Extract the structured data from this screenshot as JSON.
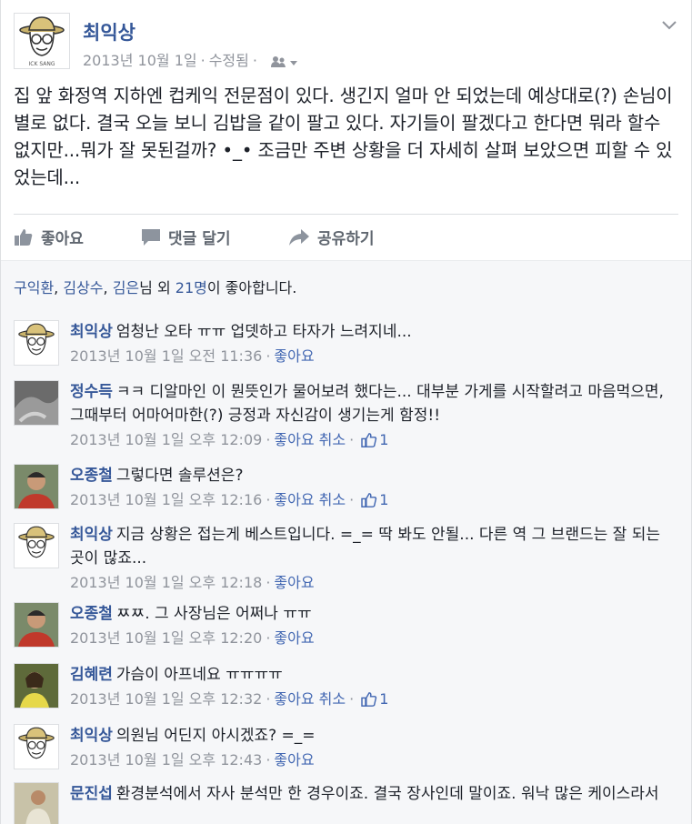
{
  "post": {
    "author": "최익상",
    "timestamp": "2013년 10월 1일",
    "edited": "수정됨",
    "body": "집 앞 화정역 지하엔 컵케익 전문점이 있다. 생긴지 얼마 안 되었는데 예상대로(?) 손님이 별로 없다. 결국 오늘 보니 김밥을 같이 팔고 있다. 자기들이 팔겠다고 한다면 뭐라 할수 없지만...뭐가 잘 못된걸까? •_• 조금만 주변 상황을 더 자세히 살펴 보았으면 피할 수 있었는데...",
    "actions": {
      "like": "좋아요",
      "comment": "댓글 달기",
      "share": "공유하기"
    }
  },
  "likes_summary": {
    "name1": "구익환",
    "name2": "김상수",
    "name3": "김은",
    "suffix1": "님 외 ",
    "others": "21명",
    "suffix2": "이 좋아합니다."
  },
  "comments": [
    {
      "author": "최익상",
      "text": "엄청난 오타 ㅠㅠ 업뎃하고 타자가 느려지네...",
      "time": "2013년 10월 1일 오전 11:36",
      "like": "좋아요",
      "cancel": "",
      "likes": ""
    },
    {
      "author": "정수득",
      "text": "ㅋㅋ 디알마인 이 뭔뜻인가 물어보려 했다는... 대부분 가게를 시작할려고 마음먹으면, 그때부터 어마어마한(?) 긍정과 자신감이 생기는게 함정!!",
      "time": "2013년 10월 1일 오후 12:09",
      "like": "좋아요",
      "cancel": "취소",
      "likes": "1"
    },
    {
      "author": "오종철",
      "text": "그렇다면 솔루션은?",
      "time": "2013년 10월 1일 오후 12:16",
      "like": "좋아요",
      "cancel": "취소",
      "likes": "1"
    },
    {
      "author": "최익상",
      "text": "지금 상황은 접는게 베스트입니다. =_= 딱 봐도 안될... 다른 역 그 브랜드는 잘 되는 곳이 많죠...",
      "time": "2013년 10월 1일 오후 12:18",
      "like": "좋아요",
      "cancel": "",
      "likes": ""
    },
    {
      "author": "오종철",
      "text": "ㅉㅉ. 그 사장님은 어쩌나 ㅠㅠ",
      "time": "2013년 10월 1일 오후 12:20",
      "like": "좋아요",
      "cancel": "",
      "likes": ""
    },
    {
      "author": "김혜련",
      "text": "가슴이 아프네요 ㅠㅠㅠㅠ",
      "time": "2013년 10월 1일 오후 12:32",
      "like": "좋아요",
      "cancel": "취소",
      "likes": "1"
    },
    {
      "author": "최익상",
      "text": "의원님 어딘지 아시겠죠? =_=",
      "time": "2013년 10월 1일 오후 12:43",
      "like": "좋아요",
      "cancel": "",
      "likes": ""
    },
    {
      "author": "문진섭",
      "text": "환경분석에서 자사 분석만 한 경우이죠. 결국 장사인데 말이죠. 워낙 많은 케이스라서",
      "time": "",
      "like": "",
      "cancel": "",
      "likes": ""
    }
  ],
  "avatar_logo_text": "ICK SANG",
  "colors": {
    "link": "#365899",
    "meta": "#90949c",
    "accent": "#4267b2",
    "bg": "#f6f7f9"
  }
}
